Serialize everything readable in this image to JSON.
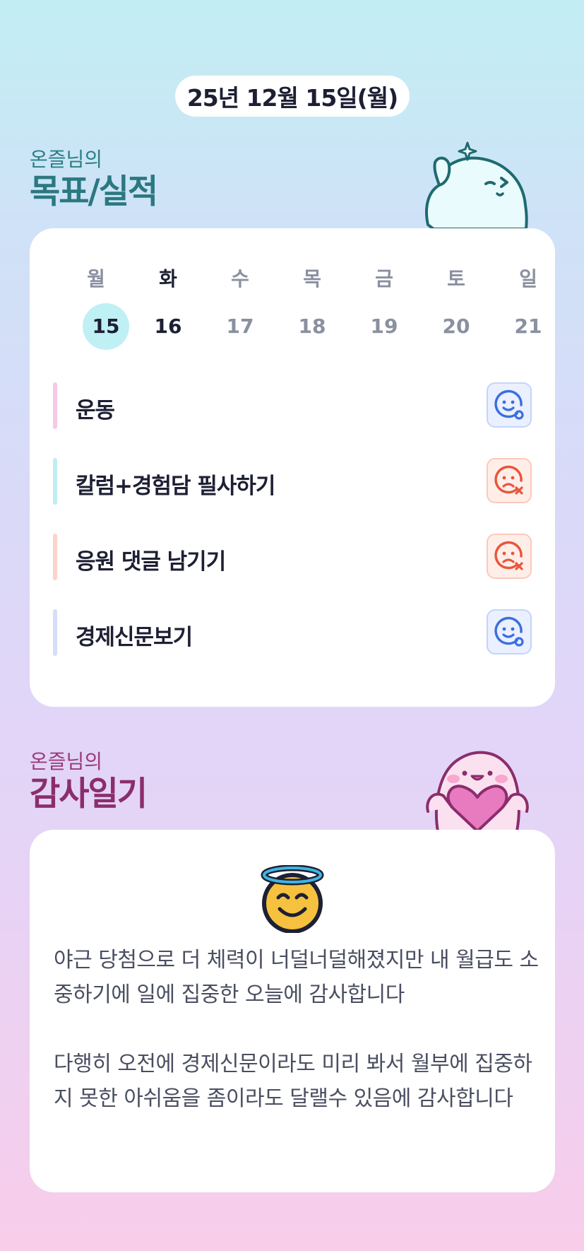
{
  "date": "25년 12월 15일(월)",
  "goals_section": {
    "subtitle": "온즐님의",
    "title": "목표/실적"
  },
  "week": {
    "days": [
      "월",
      "화",
      "수",
      "목",
      "금",
      "토",
      "일"
    ],
    "dates": [
      "15",
      "16",
      "17",
      "18",
      "19",
      "20",
      "21"
    ],
    "selected_index": 0
  },
  "goals": [
    {
      "label": "운동",
      "status": "success",
      "bar_color": "#f7c8e6"
    },
    {
      "label": "칼럼+경험담 필사하기",
      "status": "fail",
      "bar_color": "#bdeef2"
    },
    {
      "label": "응원 댓글 남기기",
      "status": "fail",
      "bar_color": "#fcd2cc"
    },
    {
      "label": "경제신문보기",
      "status": "success",
      "bar_color": "#d4def8"
    }
  ],
  "gratitude_section": {
    "subtitle": "온즐님의",
    "title": "감사일기"
  },
  "gratitude": {
    "emoji": "smiling-face-with-halo-icon",
    "paragraphs": [
      "야근 당첨으로 더 체력이 너덜너덜해졌지만 내 월급도 소중하기에 일에 집중한 오늘에 감사합니다",
      "다행히 오전에 경제신문이라도 미리 봐서 월부에 집중하지 못한 아쉬움을 좀이라도 달랠수 있음에 감사합니다"
    ]
  },
  "colors": {
    "teal_title": "#2b7880",
    "plum_title": "#8b2d6c",
    "selected_day": "#bff0f4",
    "success_icon": "#3a6fe0",
    "fail_icon": "#e8563c"
  }
}
